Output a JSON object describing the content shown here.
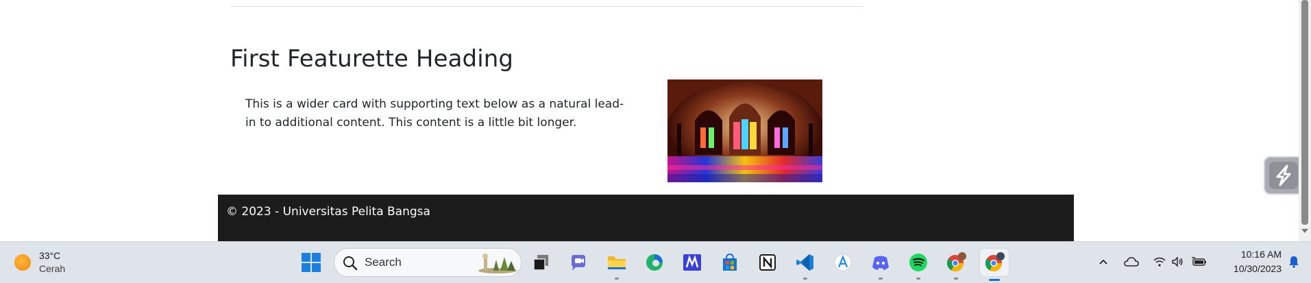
{
  "page": {
    "heading": "First Featurette Heading",
    "card_text": "This is a wider card with supporting text below as a natural lead-in to additional content. This content is a little bit longer.",
    "image_icon": "mosque-interior-photo",
    "footer_text": "© 2023 - Universitas Pelita Bangsa"
  },
  "taskbar": {
    "weather": {
      "temp": "33°C",
      "condition": "Cerah",
      "icon": "sun-icon"
    },
    "search_placeholder": "Search",
    "apps": [
      {
        "name": "start",
        "icon": "windows-logo-icon"
      },
      {
        "name": "task-view",
        "icon": "task-view-icon"
      },
      {
        "name": "teams-chat",
        "icon": "chat-camera-icon"
      },
      {
        "name": "file-explorer",
        "icon": "folder-icon"
      },
      {
        "name": "edge",
        "icon": "edge-browser-icon"
      },
      {
        "name": "dev-app",
        "icon": "m-logo-icon"
      },
      {
        "name": "microsoft-store",
        "icon": "store-bag-icon"
      },
      {
        "name": "notion",
        "icon": "notion-icon"
      },
      {
        "name": "vscode",
        "icon": "vscode-icon"
      },
      {
        "name": "app-store",
        "icon": "a-store-icon"
      },
      {
        "name": "discord",
        "icon": "discord-icon"
      },
      {
        "name": "spotify",
        "icon": "spotify-icon"
      },
      {
        "name": "chrome-profile-1",
        "icon": "chrome-icon"
      },
      {
        "name": "chrome-profile-2",
        "icon": "chrome-icon"
      }
    ],
    "tray": [
      "chevron-up-icon",
      "cloud-icon",
      "wifi-icon",
      "speaker-icon",
      "battery-icon",
      "notification-bell-icon"
    ],
    "clock": {
      "time": "10:16 AM",
      "date": "10/30/2023"
    }
  },
  "colors": {
    "footer_bg": "#1c1c1c",
    "taskbar_bg": "#dfe3ea",
    "text": "#212529",
    "active_indicator": "#1a6fd6"
  }
}
